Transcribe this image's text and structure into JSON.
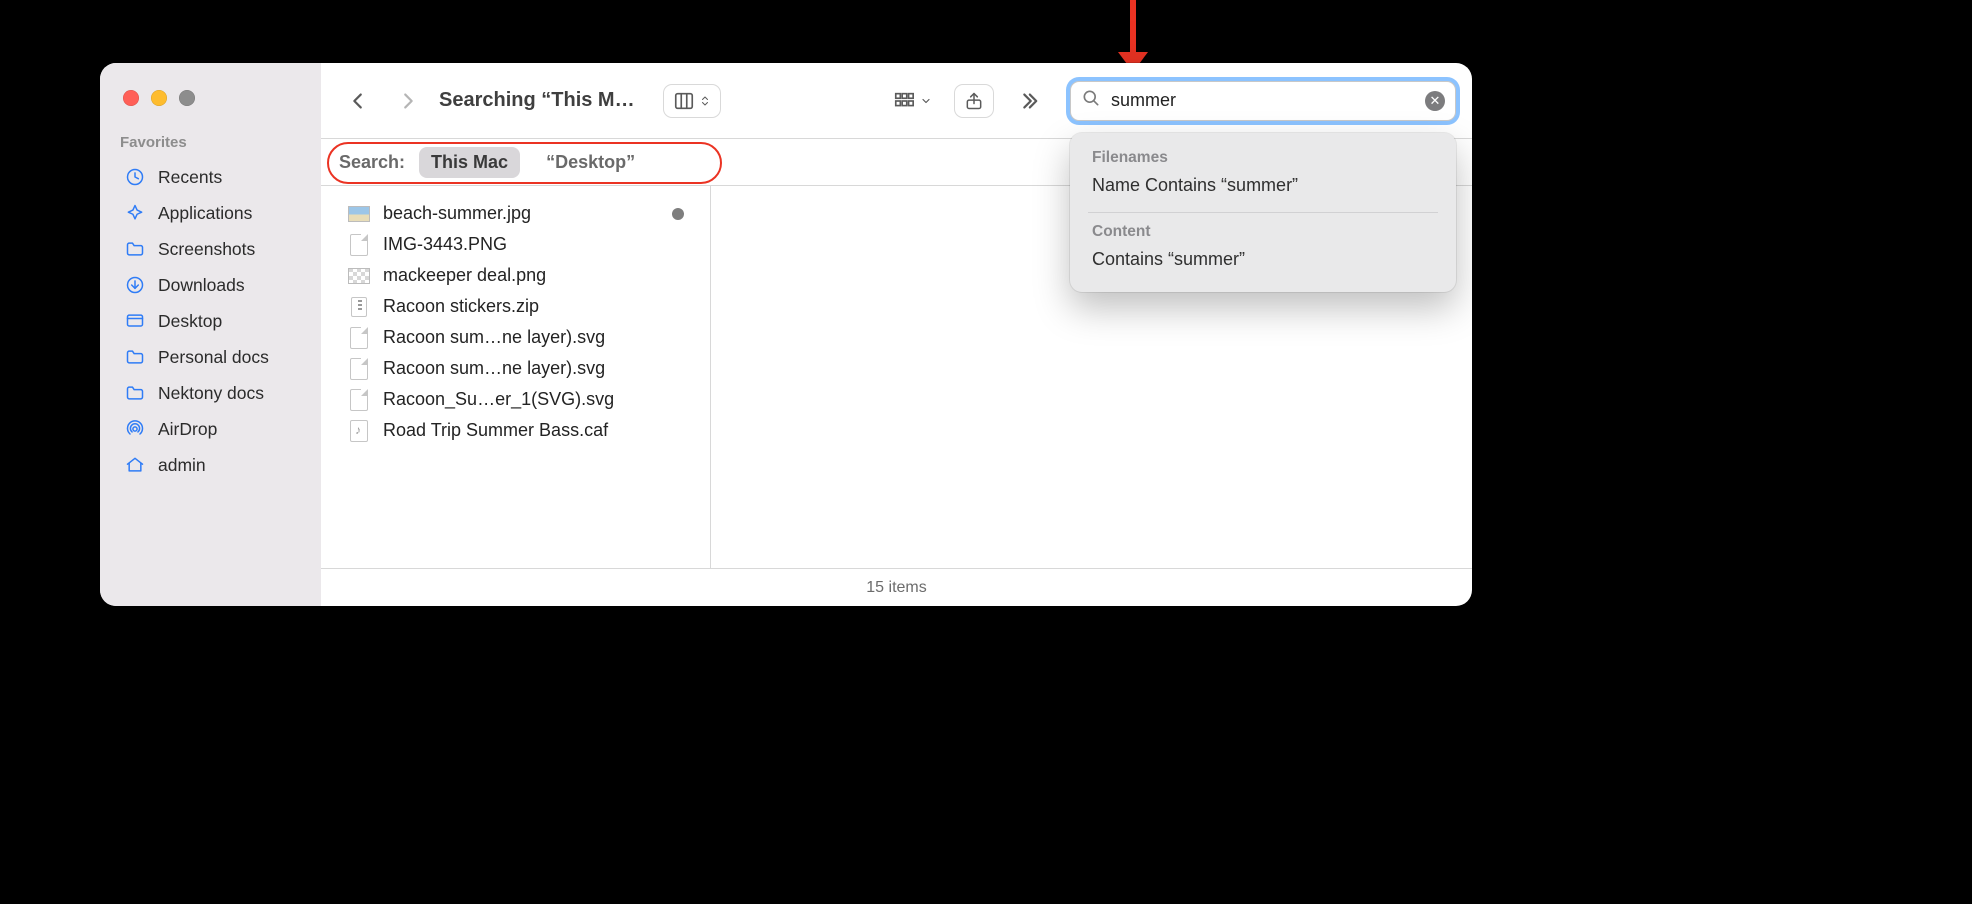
{
  "annotation": {
    "arrow_color": "#eb3323"
  },
  "window": {
    "title": "Searching “This M…"
  },
  "sidebar": {
    "header": "Favorites",
    "items": [
      {
        "id": "recents",
        "label": "Recents",
        "icon": "clock"
      },
      {
        "id": "applications",
        "label": "Applications",
        "icon": "apps"
      },
      {
        "id": "screenshots",
        "label": "Screenshots",
        "icon": "folder"
      },
      {
        "id": "downloads",
        "label": "Downloads",
        "icon": "download"
      },
      {
        "id": "desktop",
        "label": "Desktop",
        "icon": "desktop"
      },
      {
        "id": "personal",
        "label": "Personal docs",
        "icon": "folder"
      },
      {
        "id": "nektony",
        "label": "Nektony docs",
        "icon": "folder"
      },
      {
        "id": "airdrop",
        "label": "AirDrop",
        "icon": "airdrop"
      },
      {
        "id": "admin",
        "label": "admin",
        "icon": "home"
      }
    ]
  },
  "toolbar": {
    "search_value": "summer"
  },
  "scope": {
    "label": "Search:",
    "options": [
      {
        "id": "this-mac",
        "label": "This Mac",
        "selected": true
      },
      {
        "id": "desktop",
        "label": "“Desktop”",
        "selected": false
      }
    ]
  },
  "suggestions": {
    "sections": [
      {
        "title": "Filenames",
        "item": "Name Contains “summer”"
      },
      {
        "title": "Content",
        "item": "Contains “summer”"
      }
    ]
  },
  "results": [
    {
      "name": "beach-summer.jpg",
      "kind": "jpg",
      "tag": true
    },
    {
      "name": "IMG-3443.PNG",
      "kind": "file",
      "tag": false
    },
    {
      "name": "mackeeper deal.png",
      "kind": "png",
      "tag": false
    },
    {
      "name": "Racoon stickers.zip",
      "kind": "zip",
      "tag": false
    },
    {
      "name": "Racoon sum…ne layer).svg",
      "kind": "file",
      "tag": false
    },
    {
      "name": "Racoon sum…ne layer).svg",
      "kind": "file",
      "tag": false
    },
    {
      "name": "Racoon_Su…er_1(SVG).svg",
      "kind": "file",
      "tag": false
    },
    {
      "name": "Road Trip Summer Bass.caf",
      "kind": "audio",
      "tag": false
    }
  ],
  "status": "15 items"
}
